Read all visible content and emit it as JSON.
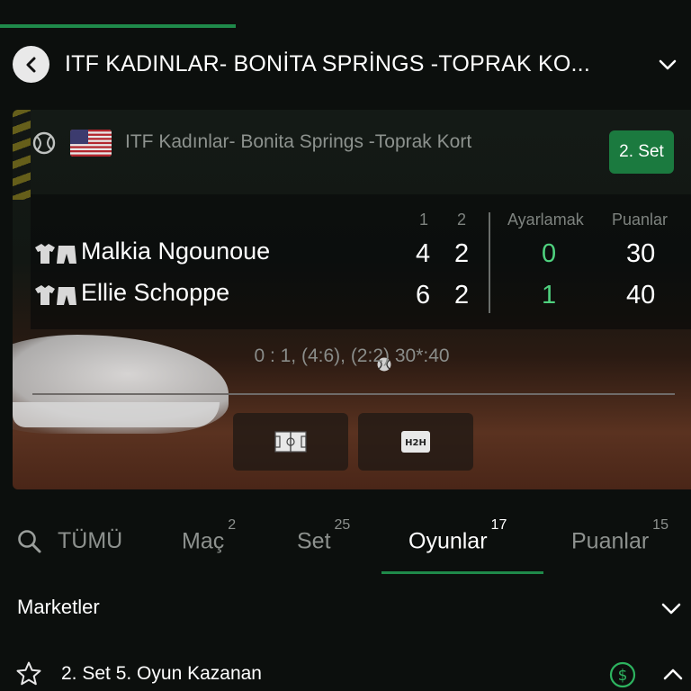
{
  "header": {
    "title": "ITF KADINLAR- BONİTA SPRİNGS -TOPRAK KO...",
    "back_icon": "chevron-left-icon",
    "expand_icon": "chevron-down-icon"
  },
  "competition": {
    "sport_icon": "tennis-ball-icon",
    "flag": "us-flag-icon",
    "name": "ITF Kadınlar- Bonita Springs -Toprak Kort",
    "set_badge": "2. Set"
  },
  "score_table": {
    "columns": [
      "1",
      "2",
      "Ayarlamak",
      "Puanlar"
    ],
    "players": [
      {
        "name": "Malkia Ngounoue",
        "serving": true,
        "set1": "4",
        "set2": "2",
        "sets": "0",
        "points": "30"
      },
      {
        "name": "Ellie Schoppe",
        "serving": false,
        "set1": "6",
        "set2": "2",
        "sets": "1",
        "points": "40"
      }
    ],
    "summary": "0 : 1, (4:6), (2:2) 30*:40"
  },
  "scoreboard_buttons": [
    {
      "icon": "court-icon"
    },
    {
      "icon": "h2h-icon",
      "label": "H2H"
    }
  ],
  "tabs": {
    "search_icon": "search-icon",
    "items": [
      {
        "label": "TÜMÜ",
        "count": ""
      },
      {
        "label": "Maç",
        "count": "2"
      },
      {
        "label": "Set",
        "count": "25"
      },
      {
        "label": "Oyunlar",
        "count": "17",
        "active": true
      },
      {
        "label": "Puanlar",
        "count": "15"
      }
    ]
  },
  "markets": {
    "label": "Marketler",
    "items": [
      {
        "label": "2. Set 5. Oyun Kazanan",
        "icons": [
          "star-icon",
          "dollar-icon",
          "chevron-up-icon"
        ]
      }
    ]
  },
  "colors": {
    "accent_green": "#1f8a4a",
    "badge_green": "#1b7a3f",
    "score_green": "#4fd27f"
  }
}
